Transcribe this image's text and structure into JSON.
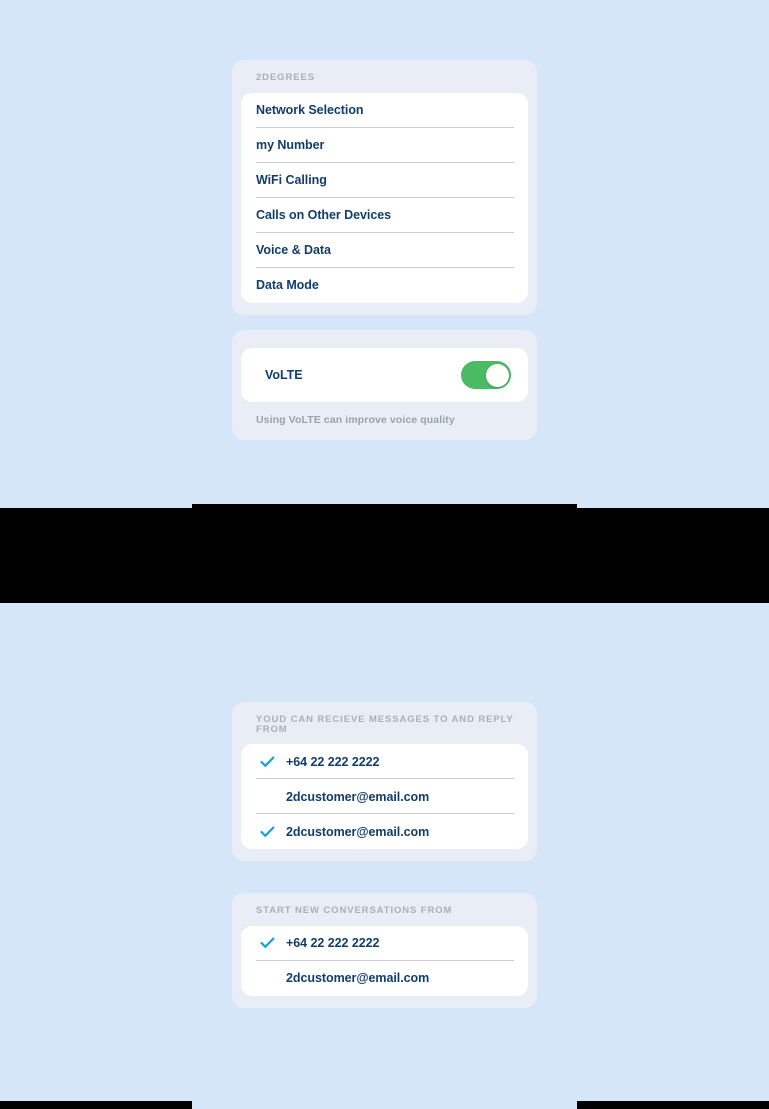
{
  "theme": {
    "page_background": "#d4e6f7",
    "group_background": "#e8edf6",
    "card_background": "#ffffff",
    "text_primary": "#123d6b",
    "text_muted": "#a8b0bd",
    "accent_check": "#1a9fd8",
    "toggle_on": "#4cb963",
    "occluder": "#000000"
  },
  "top_pane": {
    "carrier_group": {
      "label": "2DEGREES",
      "items": [
        {
          "label": "Network Selection"
        },
        {
          "label": "my Number"
        },
        {
          "label": "WiFi Calling"
        },
        {
          "label": "Calls on Other Devices"
        },
        {
          "label": "Voice & Data"
        },
        {
          "label": "Data Mode"
        }
      ]
    },
    "volte_group": {
      "label": "VoLTE",
      "toggle_state": "on",
      "footnote": "Using VoLTE can improve voice quality"
    }
  },
  "bottom_pane": {
    "receive_group": {
      "label": "YOUD CAN RECIEVE MESSAGES TO AND REPLY FROM",
      "items": [
        {
          "value": "+64 22 222 2222",
          "selected": true
        },
        {
          "value": "2dcustomer@email.com",
          "selected": false
        },
        {
          "value": "2dcustomer@email.com",
          "selected": true
        }
      ]
    },
    "start_group": {
      "label": "START NEW CONVERSATIONS FROM",
      "items": [
        {
          "value": "+64 22 222 2222",
          "selected": true
        },
        {
          "value": "2dcustomer@email.com",
          "selected": false
        }
      ]
    }
  },
  "icons": {
    "check": "check-icon",
    "toggle": "toggle-switch"
  }
}
